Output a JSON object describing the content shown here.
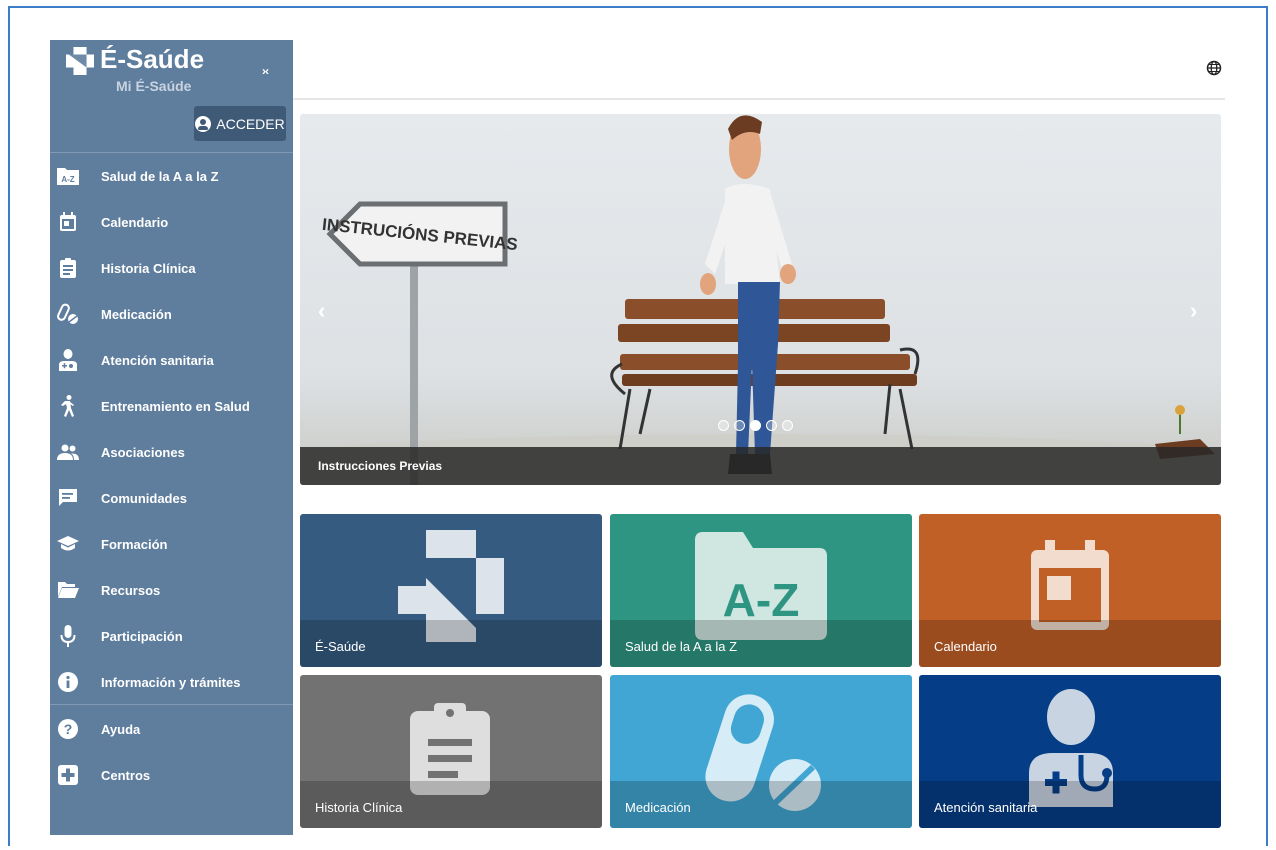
{
  "brand": {
    "title": "É-Saúde",
    "subtitle": "Mi É-Saúde",
    "collapse_label": "›‹"
  },
  "header": {
    "login_label": "ACCEDER"
  },
  "menu": [
    {
      "label": "Salud de la A a la Z",
      "icon": "az-folder-icon"
    },
    {
      "label": "Calendario",
      "icon": "calendar-icon"
    },
    {
      "label": "Historia Clínica",
      "icon": "clipboard-icon"
    },
    {
      "label": "Medicación",
      "icon": "pills-icon"
    },
    {
      "label": "Atención sanitaria",
      "icon": "doctor-icon"
    },
    {
      "label": "Entrenamiento en Salud",
      "icon": "walking-icon"
    },
    {
      "label": "Asociaciones",
      "icon": "group-icon"
    },
    {
      "label": "Comunidades",
      "icon": "chat-icon"
    },
    {
      "label": "Formación",
      "icon": "graduation-cap-icon"
    },
    {
      "label": "Recursos",
      "icon": "folder-open-icon"
    },
    {
      "label": "Participación",
      "icon": "microphone-icon"
    },
    {
      "label": "Información y trámites",
      "icon": "info-icon"
    }
  ],
  "menu_secondary": [
    {
      "label": "Ayuda",
      "icon": "help-icon"
    },
    {
      "label": "Centros",
      "icon": "plus-square-icon"
    }
  ],
  "carousel": {
    "caption": "Instrucciones Previas",
    "sign_text": "INSTRUCIÓNS PREVIAS",
    "active_slide": 3,
    "slide_count": 5,
    "prev": "‹",
    "next": "›"
  },
  "tiles": [
    {
      "label": "É-Saúde",
      "color": "#355c80"
    },
    {
      "label": "Salud de la A a la Z",
      "color": "#2f9583",
      "icon_text": "A-Z"
    },
    {
      "label": "Calendario",
      "color": "#c16026"
    },
    {
      "label": "Historia Clínica",
      "color": "#727272"
    },
    {
      "label": "Medicación",
      "color": "#41a6d3"
    },
    {
      "label": "Atención sanitaria",
      "color": "#053e86"
    }
  ]
}
